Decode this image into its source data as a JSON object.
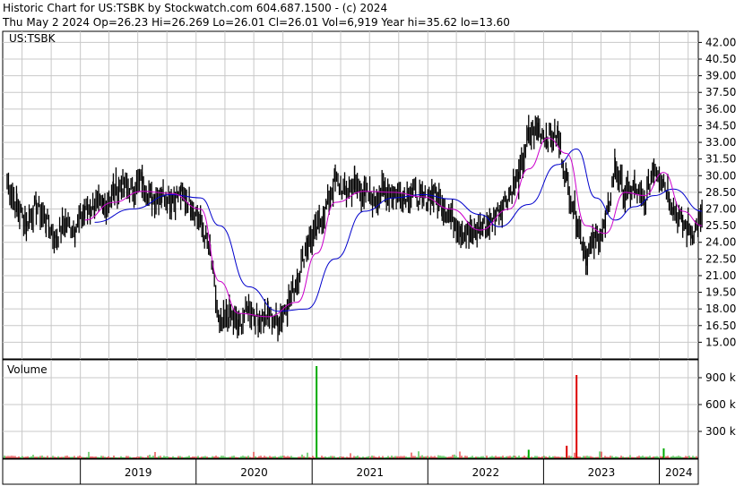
{
  "header": {
    "line1": "Historic Chart for US:TSBK by Stockwatch.com 604.687.1500 - (c) 2024",
    "line2": "Thu May  2 2024   Op=26.23   Hi=26.269   Lo=26.01   Cl=26.01   Vol=6,919   Year hi=35.62   lo=13.60"
  },
  "chart_data": [
    {
      "type": "line",
      "symbol_label": "US:TSBK",
      "y_ticks": [
        "42.00",
        "40.50",
        "39.00",
        "37.50",
        "36.00",
        "34.50",
        "33.00",
        "31.50",
        "30.00",
        "28.50",
        "27.00",
        "25.50",
        "24.00",
        "22.50",
        "21.00",
        "19.50",
        "18.00",
        "16.50",
        "15.00"
      ],
      "ylim": [
        13.5,
        43.0
      ],
      "x_labels": [
        "2019",
        "2020",
        "2021",
        "2022",
        "2023",
        "2024"
      ],
      "grid": true,
      "colors": {
        "price": "#000000",
        "ma_short": "#cc00cc",
        "ma_long": "#0000cc"
      },
      "price_points": [
        [
          "2018-05",
          29.5
        ],
        [
          "2018-06",
          27.2
        ],
        [
          "2018-07",
          25.8
        ],
        [
          "2018-08",
          27.3
        ],
        [
          "2018-09",
          26.0
        ],
        [
          "2018-10",
          24.3
        ],
        [
          "2018-11",
          25.8
        ],
        [
          "2018-12",
          25.2
        ],
        [
          "2019-01",
          26.8
        ],
        [
          "2019-02",
          27.4
        ],
        [
          "2019-03",
          27.0
        ],
        [
          "2019-04",
          28.6
        ],
        [
          "2019-05",
          29.1
        ],
        [
          "2019-06",
          28.7
        ],
        [
          "2019-07",
          29.6
        ],
        [
          "2019-08",
          27.8
        ],
        [
          "2019-09",
          28.5
        ],
        [
          "2019-10",
          27.9
        ],
        [
          "2019-11",
          28.3
        ],
        [
          "2019-12",
          27.6
        ],
        [
          "2020-01",
          25.8
        ],
        [
          "2020-02",
          23.0
        ],
        [
          "2020-03",
          16.2
        ],
        [
          "2020-04",
          17.5
        ],
        [
          "2020-05",
          16.4
        ],
        [
          "2020-06",
          18.2
        ],
        [
          "2020-07",
          17.0
        ],
        [
          "2020-08",
          17.4
        ],
        [
          "2020-09",
          16.8
        ],
        [
          "2020-10",
          18.4
        ],
        [
          "2020-11",
          20.6
        ],
        [
          "2020-12",
          23.8
        ],
        [
          "2021-01",
          25.0
        ],
        [
          "2021-02",
          27.2
        ],
        [
          "2021-03",
          29.6
        ],
        [
          "2021-04",
          28.5
        ],
        [
          "2021-05",
          29.3
        ],
        [
          "2021-06",
          28.4
        ],
        [
          "2021-07",
          27.9
        ],
        [
          "2021-08",
          28.7
        ],
        [
          "2021-09",
          28.4
        ],
        [
          "2021-10",
          28.2
        ],
        [
          "2021-11",
          28.6
        ],
        [
          "2021-12",
          27.7
        ],
        [
          "2022-01",
          28.4
        ],
        [
          "2022-02",
          27.5
        ],
        [
          "2022-03",
          26.3
        ],
        [
          "2022-04",
          25.2
        ],
        [
          "2022-05",
          24.6
        ],
        [
          "2022-06",
          25.3
        ],
        [
          "2022-07",
          25.7
        ],
        [
          "2022-08",
          27.0
        ],
        [
          "2022-09",
          28.4
        ],
        [
          "2022-10",
          29.8
        ],
        [
          "2022-11",
          33.6
        ],
        [
          "2022-12",
          34.2
        ],
        [
          "2023-01",
          33.4
        ],
        [
          "2023-02",
          33.6
        ],
        [
          "2023-03",
          29.5
        ],
        [
          "2023-04",
          26.2
        ],
        [
          "2023-05",
          22.8
        ],
        [
          "2023-06",
          24.3
        ],
        [
          "2023-07",
          25.4
        ],
        [
          "2023-08",
          30.9
        ],
        [
          "2023-09",
          28.2
        ],
        [
          "2023-10",
          28.9
        ],
        [
          "2023-11",
          27.4
        ],
        [
          "2023-12",
          30.9
        ],
        [
          "2024-01",
          29.6
        ],
        [
          "2024-02",
          27.1
        ],
        [
          "2024-03",
          25.6
        ],
        [
          "2024-04",
          24.9
        ],
        [
          "2024-05",
          26.0
        ]
      ],
      "ma_short_points": [
        [
          "2019-01",
          26.0
        ],
        [
          "2019-04",
          27.6
        ],
        [
          "2019-07",
          28.6
        ],
        [
          "2019-10",
          28.4
        ],
        [
          "2020-01",
          27.0
        ],
        [
          "2020-03",
          20.5
        ],
        [
          "2020-05",
          17.6
        ],
        [
          "2020-08",
          17.3
        ],
        [
          "2020-11",
          18.6
        ],
        [
          "2021-01",
          23.0
        ],
        [
          "2021-03",
          27.6
        ],
        [
          "2021-06",
          28.6
        ],
        [
          "2021-09",
          28.5
        ],
        [
          "2021-12",
          28.1
        ],
        [
          "2022-03",
          27.0
        ],
        [
          "2022-06",
          25.1
        ],
        [
          "2022-09",
          27.0
        ],
        [
          "2022-11",
          30.6
        ],
        [
          "2023-01",
          33.4
        ],
        [
          "2023-03",
          32.0
        ],
        [
          "2023-05",
          25.5
        ],
        [
          "2023-07",
          24.8
        ],
        [
          "2023-09",
          28.5
        ],
        [
          "2023-11",
          28.2
        ],
        [
          "2024-01",
          30.3
        ],
        [
          "2024-03",
          26.8
        ],
        [
          "2024-05",
          25.5
        ]
      ],
      "ma_long_points": [
        [
          "2019-02",
          25.8
        ],
        [
          "2019-06",
          27.0
        ],
        [
          "2019-10",
          28.3
        ],
        [
          "2020-01",
          28.0
        ],
        [
          "2020-03",
          25.5
        ],
        [
          "2020-06",
          20.0
        ],
        [
          "2020-09",
          17.8
        ],
        [
          "2020-12",
          18.0
        ],
        [
          "2021-03",
          22.5
        ],
        [
          "2021-06",
          26.8
        ],
        [
          "2021-09",
          28.0
        ],
        [
          "2021-12",
          28.3
        ],
        [
          "2022-03",
          27.9
        ],
        [
          "2022-06",
          26.5
        ],
        [
          "2022-08",
          25.4
        ],
        [
          "2022-11",
          27.4
        ],
        [
          "2023-02",
          31.0
        ],
        [
          "2023-04",
          32.4
        ],
        [
          "2023-06",
          28.0
        ],
        [
          "2023-08",
          26.0
        ],
        [
          "2023-10",
          27.2
        ],
        [
          "2023-12",
          28.2
        ],
        [
          "2024-02",
          28.8
        ],
        [
          "2024-05",
          26.8
        ]
      ]
    },
    {
      "type": "bar",
      "title": "Volume",
      "y_ticks": [
        "900 k",
        "600 k",
        "300 k"
      ],
      "ylim": [
        0,
        1100
      ],
      "baseline_unit": "k",
      "colors": {
        "up": "#00aa00",
        "down": "#dd0000"
      },
      "spikes": [
        {
          "x": "2021-01",
          "value": 1030,
          "color": "up"
        },
        {
          "x": "2023-04",
          "value": 930,
          "color": "down"
        },
        {
          "x": "2022-11",
          "value": 95,
          "color": "up"
        },
        {
          "x": "2023-03",
          "value": 140,
          "color": "down"
        },
        {
          "x": "2024-01",
          "value": 110,
          "color": "up"
        }
      ]
    }
  ]
}
